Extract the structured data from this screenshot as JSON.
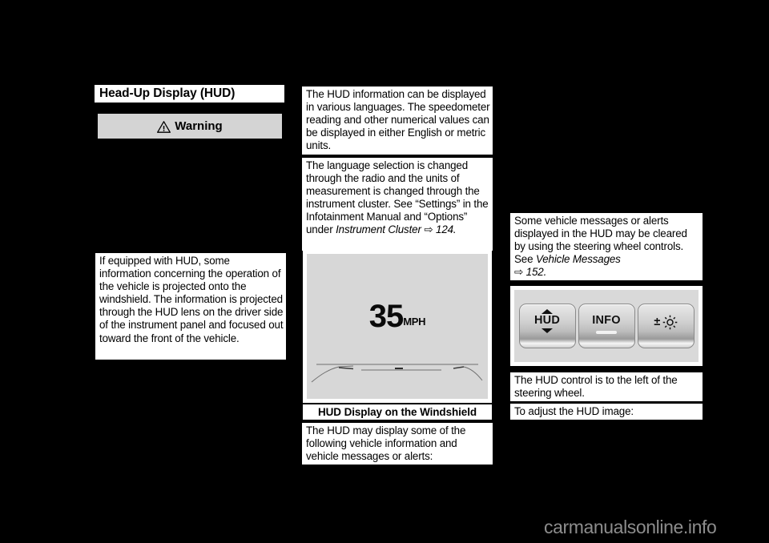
{
  "page": {
    "background_color": "#000000",
    "watermark": "carmanualsonline.info"
  },
  "column_left": {
    "heading": "Head-Up Display (HUD)",
    "warning_bar": {
      "label": "Warning",
      "icon": "warning-triangle-icon",
      "background_color": "#d4d4d4"
    },
    "paragraph": "If equipped with HUD, some information concerning the operation of the vehicle is projected onto the windshield. The information is projected through the HUD lens on the driver side of the instrument panel and focused out toward the front of the vehicle."
  },
  "column_middle": {
    "paragraph_1": "The HUD information can be displayed in various languages. The speedometer reading and other numerical values can be displayed in either English or metric units.",
    "paragraph_2_pre": "The language selection is changed through the radio and the units of measurement is changed through the instrument cluster. See “Settings” in the Infotainment Manual and “Options” under ",
    "paragraph_2_ref": "Instrument Cluster",
    "paragraph_2_arrow": "⇨",
    "paragraph_2_page": "124",
    "paragraph_2_post": ".",
    "figure": {
      "speed_value": "35",
      "speed_unit": "MPH",
      "caption": "HUD Display on the Windshield",
      "background_color": "#d7d7d7"
    },
    "paragraph_3": "The HUD may display some of the following vehicle information and vehicle messages or alerts:"
  },
  "column_right": {
    "paragraph_1_pre": "Some vehicle messages or alerts displayed in the HUD may be cleared by using the steering wheel controls. See ",
    "paragraph_1_ref": "Vehicle Messages",
    "paragraph_1_arrow": "⇨",
    "paragraph_1_page": "152",
    "paragraph_1_post": ".",
    "controls_figure": {
      "background_color": "#d9d9d9",
      "buttons": [
        {
          "name": "hud-button",
          "label": "HUD",
          "has_up_arrow": true,
          "has_down_arrow": true
        },
        {
          "name": "info-button",
          "label": "INFO",
          "has_indicator": true
        },
        {
          "name": "brightness-button",
          "label": "±",
          "icon": "sun-brightness-icon"
        }
      ]
    },
    "paragraph_2": "The HUD control is to the left of the steering wheel.",
    "paragraph_3": "To adjust the HUD image:"
  }
}
